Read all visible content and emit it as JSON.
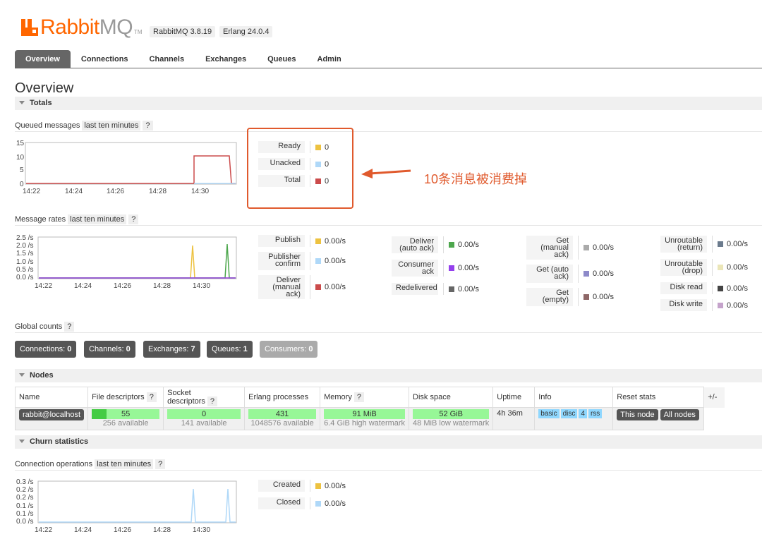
{
  "header": {
    "logo_rabbit": "Rabbit",
    "logo_mq": "MQ",
    "logo_tm": "TM",
    "version_rabbit": "RabbitMQ 3.8.19",
    "version_erlang": "Erlang 24.0.4",
    "brand_color": "#ff6600"
  },
  "tabs": [
    "Overview",
    "Connections",
    "Channels",
    "Exchanges",
    "Queues",
    "Admin"
  ],
  "page_title": "Overview",
  "totals": {
    "section_label": "Totals",
    "queued_label": "Queued messages",
    "range_label": "last ten minutes",
    "help": "?",
    "chart": {
      "y_ticks": [
        "15",
        "10",
        "5",
        "0"
      ],
      "x_ticks": [
        "14:22",
        "14:24",
        "14:26",
        "14:28",
        "14:30"
      ]
    },
    "legend": [
      {
        "key": "Ready",
        "value": "0",
        "color": "#edc240"
      },
      {
        "key": "Unacked",
        "value": "0",
        "color": "#afd8f8"
      },
      {
        "key": "Total",
        "value": "0",
        "color": "#cb4b4b"
      }
    ]
  },
  "rates": {
    "label": "Message rates",
    "range_label": "last ten minutes",
    "help": "?",
    "chart": {
      "y_ticks": [
        "2.5 /s",
        "2.0 /s",
        "1.5 /s",
        "1.0 /s",
        "0.5 /s",
        "0.0 /s"
      ],
      "x_ticks": [
        "14:22",
        "14:24",
        "14:26",
        "14:28",
        "14:30"
      ]
    },
    "col1": [
      {
        "key": "Publish",
        "value": "0.00/s",
        "color": "#edc240"
      },
      {
        "key": "Publisher confirm",
        "value": "0.00/s",
        "color": "#afd8f8"
      },
      {
        "key": "Deliver (manual ack)",
        "value": "0.00/s",
        "color": "#cb4b4b"
      }
    ],
    "col2": [
      {
        "key": "Deliver (auto ack)",
        "value": "0.00/s",
        "color": "#4da74d"
      },
      {
        "key": "Consumer ack",
        "value": "0.00/s",
        "color": "#9440ed"
      },
      {
        "key": "Redelivered",
        "value": "0.00/s",
        "color": "#666666"
      }
    ],
    "col3": [
      {
        "key": "Get (manual ack)",
        "value": "0.00/s",
        "color": "#aaaaaa"
      },
      {
        "key": "Get (auto ack)",
        "value": "0.00/s",
        "color": "#8d8ac9"
      },
      {
        "key": "Get (empty)",
        "value": "0.00/s",
        "color": "#8e6767"
      }
    ],
    "col4": [
      {
        "key": "Unroutable (return)",
        "value": "0.00/s",
        "color": "#6b7b8d"
      },
      {
        "key": "Unroutable (drop)",
        "value": "0.00/s",
        "color": "#ebe6b8"
      },
      {
        "key": "Disk read",
        "value": "0.00/s",
        "color": "#444444"
      },
      {
        "key": "Disk write",
        "value": "0.00/s",
        "color": "#c5a3cb"
      }
    ]
  },
  "global": {
    "label": "Global counts",
    "help": "?",
    "counts": [
      {
        "label": "Connections:",
        "value": "0"
      },
      {
        "label": "Channels:",
        "value": "0"
      },
      {
        "label": "Exchanges:",
        "value": "7"
      },
      {
        "label": "Queues:",
        "value": "1"
      },
      {
        "label": "Consumers:",
        "value": "0"
      }
    ]
  },
  "nodes": {
    "section_label": "Nodes",
    "headers": {
      "name": "Name",
      "fd": "File descriptors",
      "sd": "Socket descriptors",
      "ep": "Erlang processes",
      "mem": "Memory",
      "disk": "Disk space",
      "uptime": "Uptime",
      "info": "Info",
      "reset": "Reset stats",
      "plusminus": "+/-",
      "help": "?"
    },
    "row": {
      "name": "rabbit@localhost",
      "fd": "55",
      "fd_avail": "256 available",
      "sd": "0",
      "sd_avail": "141 available",
      "ep": "431",
      "ep_avail": "1048576 available",
      "mem": "91 MiB",
      "mem_note": "6.4 GiB high watermark",
      "disk": "52 GiB",
      "disk_note": "48 MiB low watermark",
      "uptime": "4h 36m",
      "info_tags": [
        "basic",
        "disc",
        "4",
        "rss"
      ],
      "this_node": "This node",
      "all_nodes": "All nodes"
    }
  },
  "churn": {
    "section_label": "Churn statistics",
    "label": "Connection operations",
    "range_label": "last ten minutes",
    "help": "?",
    "chart": {
      "y_ticks": [
        "0.3 /s",
        "0.2 /s",
        "0.2 /s",
        "0.1 /s",
        "0.1 /s",
        "0.0 /s"
      ],
      "x_ticks": [
        "14:22",
        "14:24",
        "14:26",
        "14:28",
        "14:30"
      ]
    },
    "legend": [
      {
        "key": "Created",
        "value": "0.00/s",
        "color": "#edc240"
      },
      {
        "key": "Closed",
        "value": "0.00/s",
        "color": "#afd8f8"
      }
    ]
  },
  "annotation": {
    "text": "10条消息被消费掉",
    "color": "#e05a2d"
  }
}
